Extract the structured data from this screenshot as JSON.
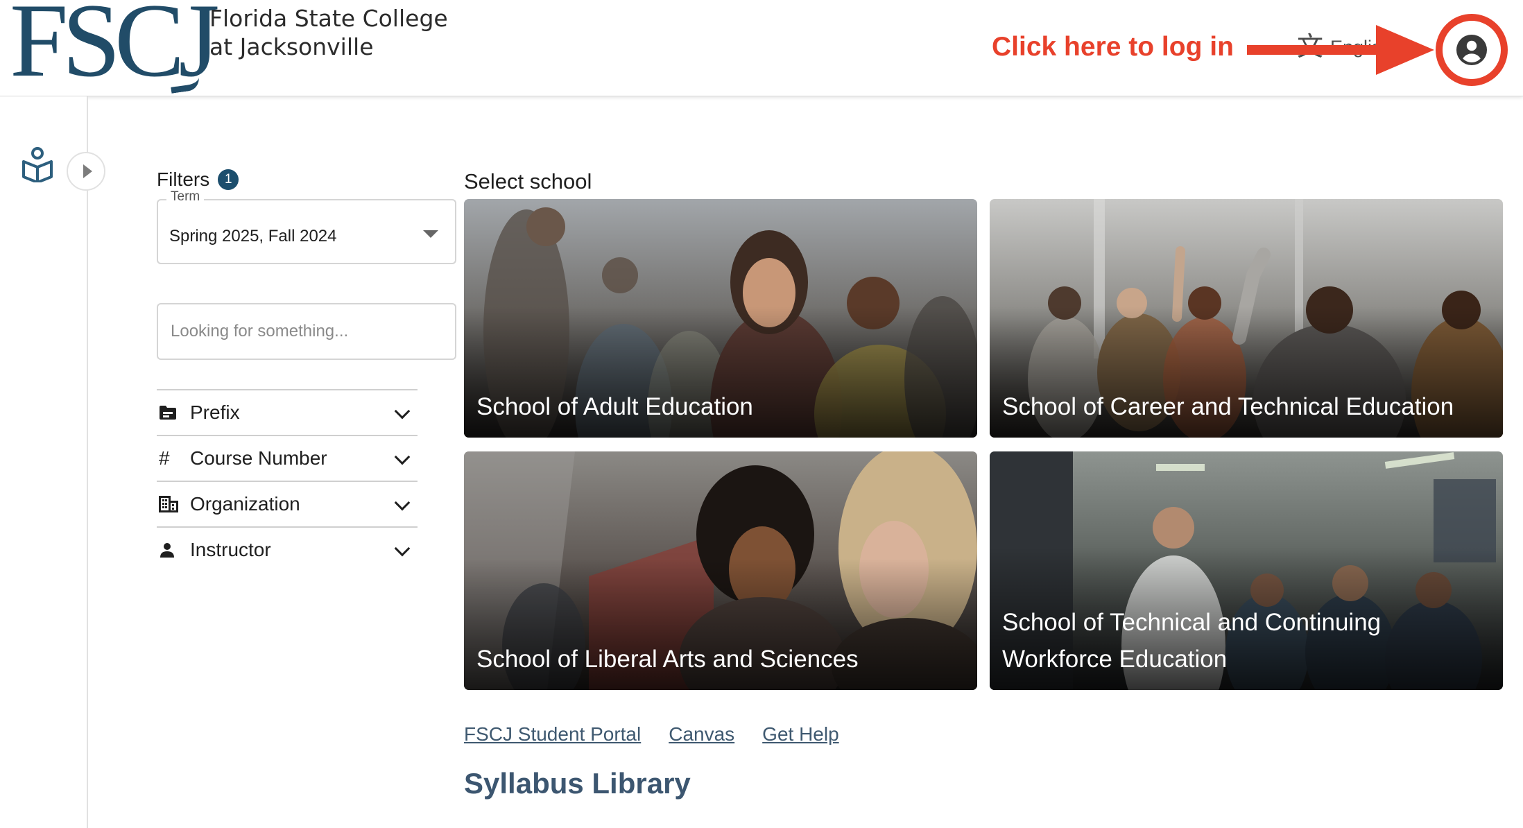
{
  "header": {
    "logo_mark": "FSCJ",
    "logo_line1": "Florida State College",
    "logo_line2": "at Jacksonville",
    "language_label": "English",
    "login_label": "Log in"
  },
  "annotation": {
    "text": "Click here to log in",
    "color": "#e8412b"
  },
  "sidebar": {
    "icon": "library-book-icon",
    "toggle_icon": "expand-arrow-icon"
  },
  "filters": {
    "title": "Filters",
    "active_count": "1",
    "term": {
      "label": "Term",
      "value": "Spring 2025, Fall 2024"
    },
    "search": {
      "placeholder": "Looking for something..."
    },
    "facets": [
      {
        "label": "Prefix",
        "icon": "folder-icon"
      },
      {
        "label": "Course Number",
        "icon": "hash-icon"
      },
      {
        "label": "Organization",
        "icon": "building-icon"
      },
      {
        "label": "Instructor",
        "icon": "person-icon"
      }
    ]
  },
  "schools": {
    "title": "Select school",
    "items": [
      {
        "label": "School of Adult Education"
      },
      {
        "label": "School of Career and Technical Education"
      },
      {
        "label": "School of Liberal Arts and Sciences"
      },
      {
        "label": "School of Technical and Continuing Workforce Education"
      }
    ]
  },
  "footer": {
    "links": [
      "FSCJ Student Portal",
      "Canvas",
      "Get Help"
    ],
    "library_title": "Syllabus Library"
  },
  "colors": {
    "brand": "#214c68",
    "link": "#3f5970",
    "annotation": "#e8412b"
  }
}
